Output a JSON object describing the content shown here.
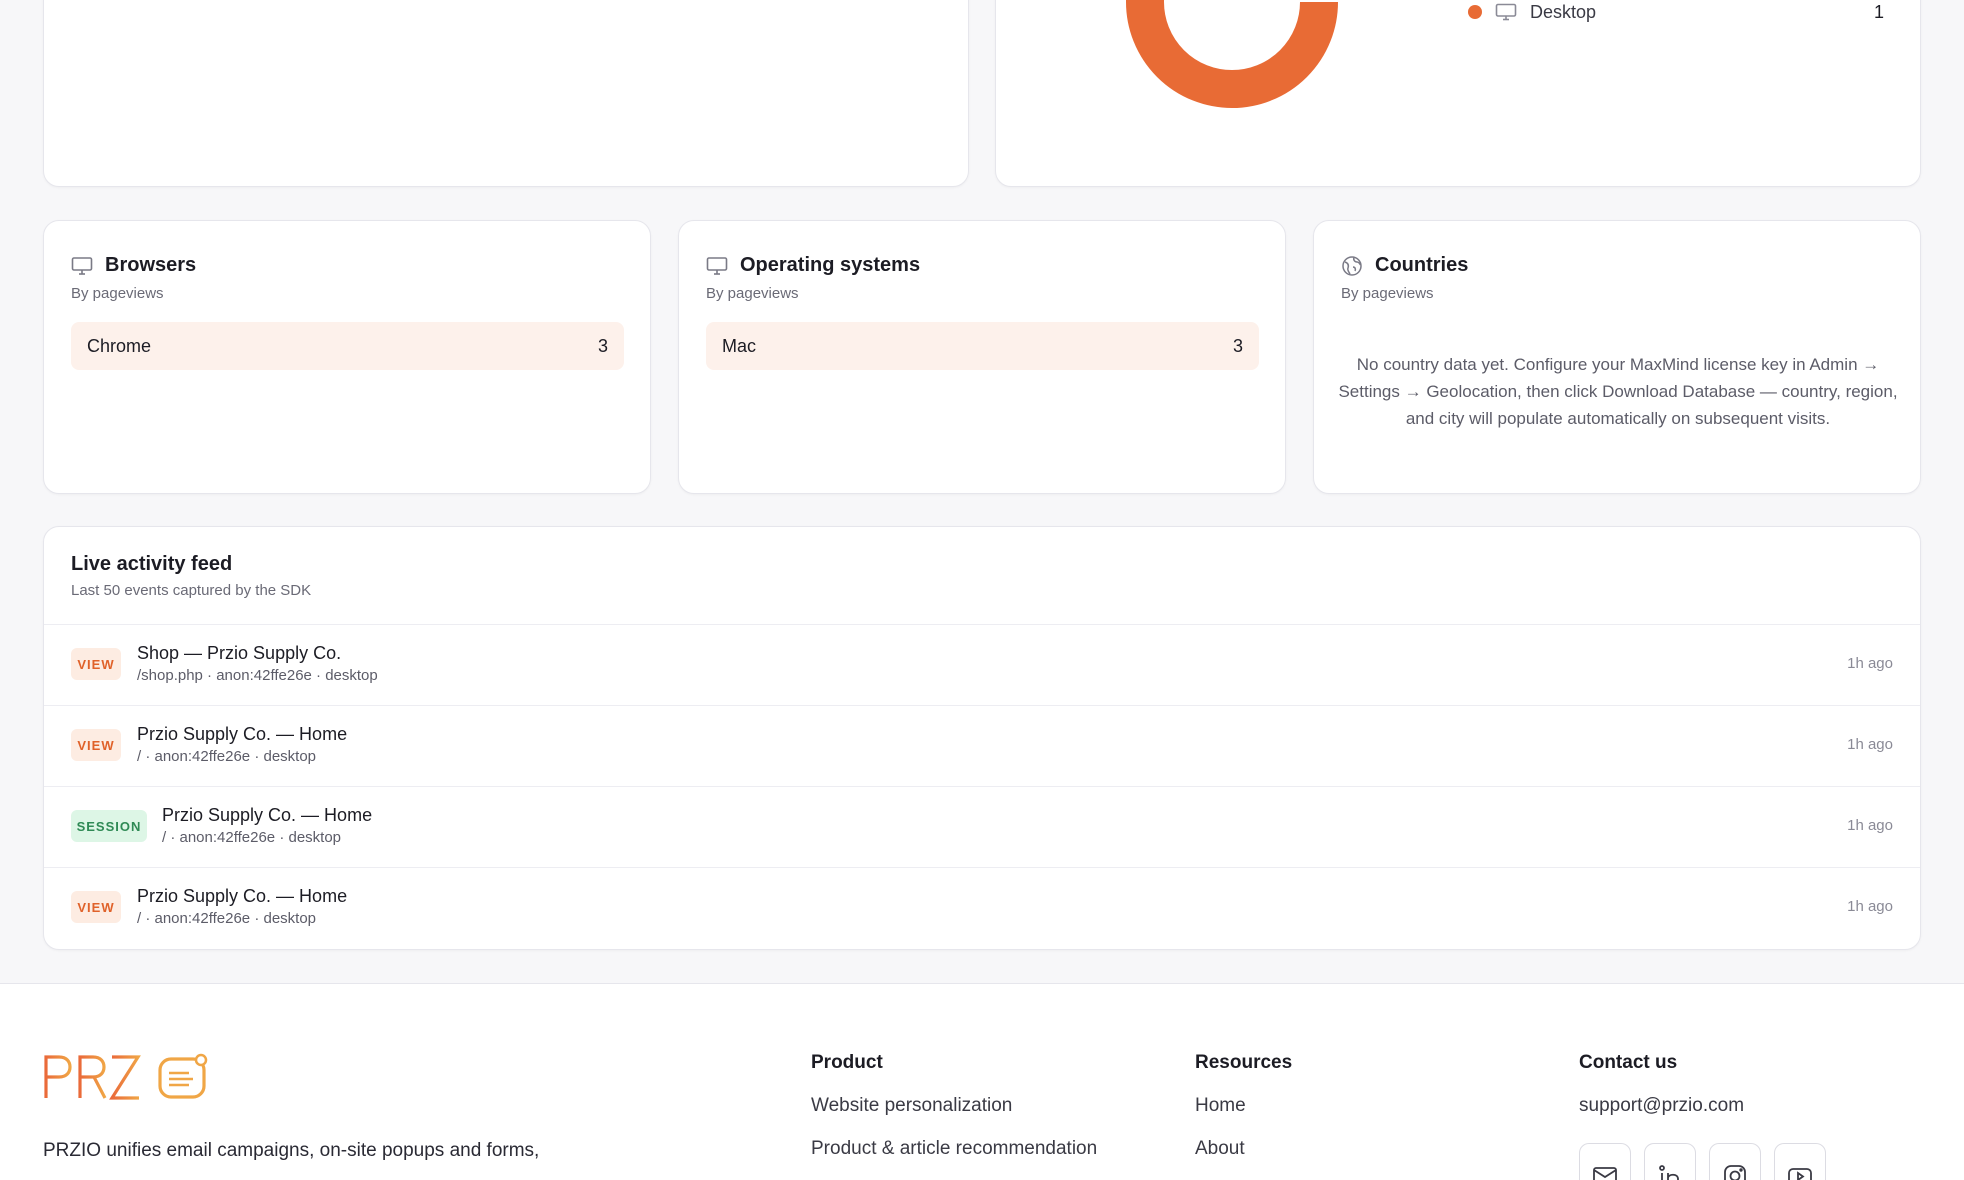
{
  "device_legend": {
    "label": "Desktop",
    "value": "1",
    "color": "#e86b35"
  },
  "browsers": {
    "title": "Browsers",
    "subtitle": "By pageviews",
    "rows": [
      {
        "label": "Chrome",
        "value": "3"
      }
    ]
  },
  "operating_systems": {
    "title": "Operating systems",
    "subtitle": "By pageviews",
    "rows": [
      {
        "label": "Mac",
        "value": "3"
      }
    ]
  },
  "countries": {
    "title": "Countries",
    "subtitle": "By pageviews",
    "empty_message": "No country data yet. Configure your MaxMind license key in Admin → Settings → Geolocation, then click Download Database — country, region, and city will populate automatically on subsequent visits."
  },
  "feed": {
    "title": "Live activity feed",
    "subtitle": "Last 50 events captured by the SDK",
    "events": [
      {
        "type": "VIEW",
        "name": "Shop — Przio Supply Co.",
        "meta": "/shop.php · anon:42ffe26e · desktop",
        "time": "1h ago"
      },
      {
        "type": "VIEW",
        "name": "Przio Supply Co. — Home",
        "meta": "/ · anon:42ffe26e · desktop",
        "time": "1h ago"
      },
      {
        "type": "SESSION",
        "name": "Przio Supply Co. — Home",
        "meta": "/ · anon:42ffe26e · desktop",
        "time": "1h ago"
      },
      {
        "type": "VIEW",
        "name": "Przio Supply Co. — Home",
        "meta": "/ · anon:42ffe26e · desktop",
        "time": "1h ago"
      }
    ]
  },
  "footer": {
    "logo_text": "PRZIO",
    "description": "PRZIO unifies email campaigns, on-site popups and forms,",
    "product": {
      "heading": "Product",
      "links": [
        "Website personalization",
        "Product & article recommendation"
      ]
    },
    "resources": {
      "heading": "Resources",
      "links": [
        "Home",
        "About"
      ]
    },
    "contact": {
      "heading": "Contact us",
      "email": "support@przio.com"
    },
    "social_icons": [
      "mail-icon",
      "linkedin-icon",
      "instagram-icon",
      "youtube-icon"
    ]
  }
}
